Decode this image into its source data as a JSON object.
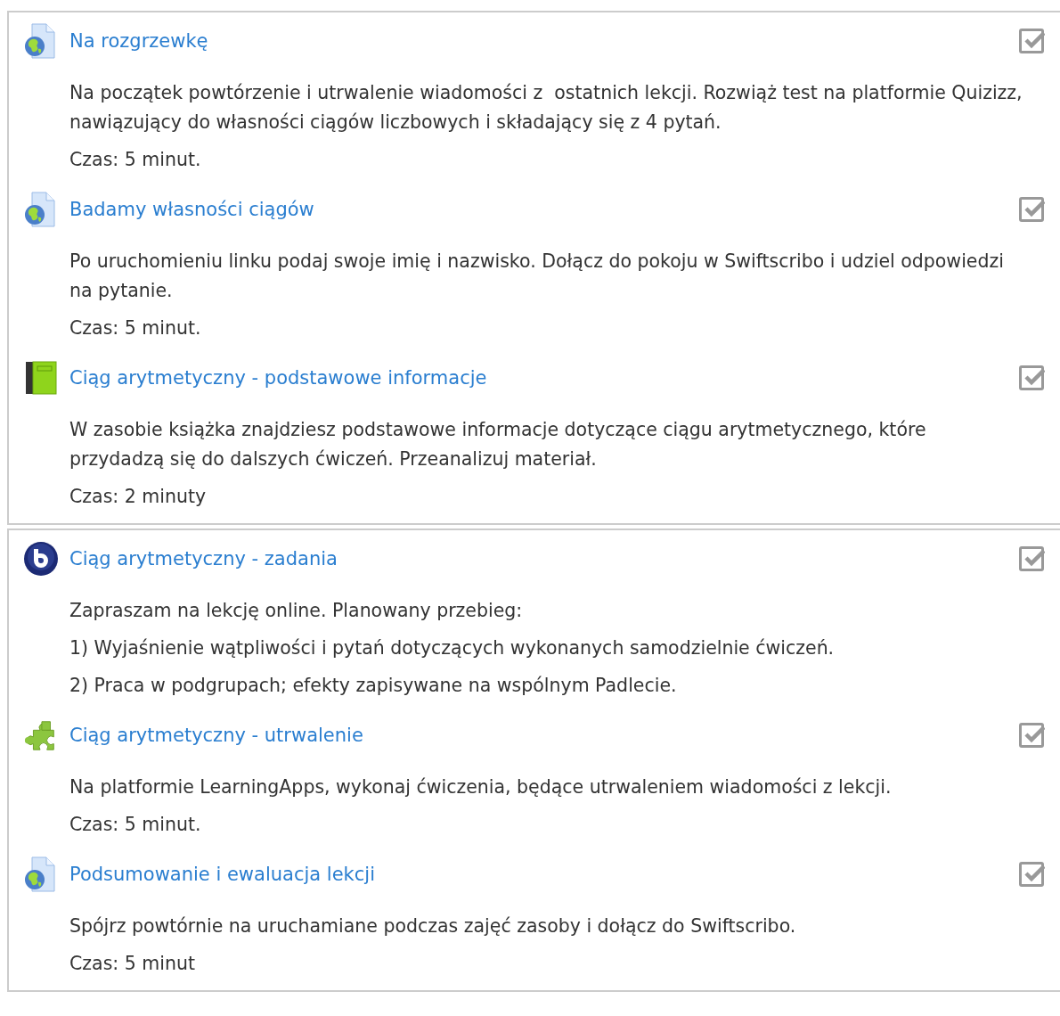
{
  "sections": [
    {
      "activities": [
        {
          "kind": "url",
          "title": "Na rozgrzewkę",
          "completion": {
            "checked": true
          },
          "paragraphs": [
            "Na początek powtórzenie i utrwalenie wiadomości z  ostatnich lekcji. Rozwiąż test na platformie Quizizz, nawiązujący do własności ciągów liczbowych i składający się z 4 pytań.",
            "Czas: 5 minut."
          ]
        },
        {
          "kind": "url",
          "title": "Badamy własności ciągów",
          "completion": {
            "checked": true
          },
          "paragraphs": [
            "Po uruchomieniu linku podaj swoje imię i nazwisko. Dołącz do pokoju w Swiftscribo i udziel odpowiedzi na pytanie.",
            "Czas: 5 minut."
          ]
        },
        {
          "kind": "book",
          "title": "Ciąg arytmetyczny - podstawowe informacje",
          "completion": {
            "checked": true
          },
          "paragraphs": [
            "W zasobie książka znajdziesz podstawowe informacje dotyczące ciągu arytmetycznego, które przydadzą się do dalszych ćwiczeń. Przeanalizuj materiał.",
            "Czas: 2 minuty"
          ]
        }
      ]
    },
    {
      "activities": [
        {
          "kind": "meeting",
          "title": "Ciąg arytmetyczny - zadania",
          "completion": {
            "checked": true
          },
          "paragraphs": [
            "Zapraszam na lekcję online. Planowany przebieg:",
            "1) Wyjaśnienie wątpliwości i pytań dotyczących wykonanych samodzielnie ćwiczeń.",
            "2) Praca w podgrupach; efekty zapisywane na wspólnym Padlecie."
          ]
        },
        {
          "kind": "puzzle",
          "title": "Ciąg arytmetyczny - utrwalenie",
          "completion": {
            "checked": true
          },
          "paragraphs": [
            "Na platformie LearningApps, wykonaj ćwiczenia, będące utrwaleniem wiadomości z lekcji.",
            "Czas: 5 minut."
          ]
        },
        {
          "kind": "url",
          "title": "Podsumowanie i ewaluacja lekcji",
          "completion": {
            "checked": true
          },
          "paragraphs": [
            "Spójrz powtórnie na uruchamiane podczas zajęć zasoby i dołącz do Swiftscribo.",
            "Czas: 5 minut"
          ]
        }
      ]
    }
  ]
}
